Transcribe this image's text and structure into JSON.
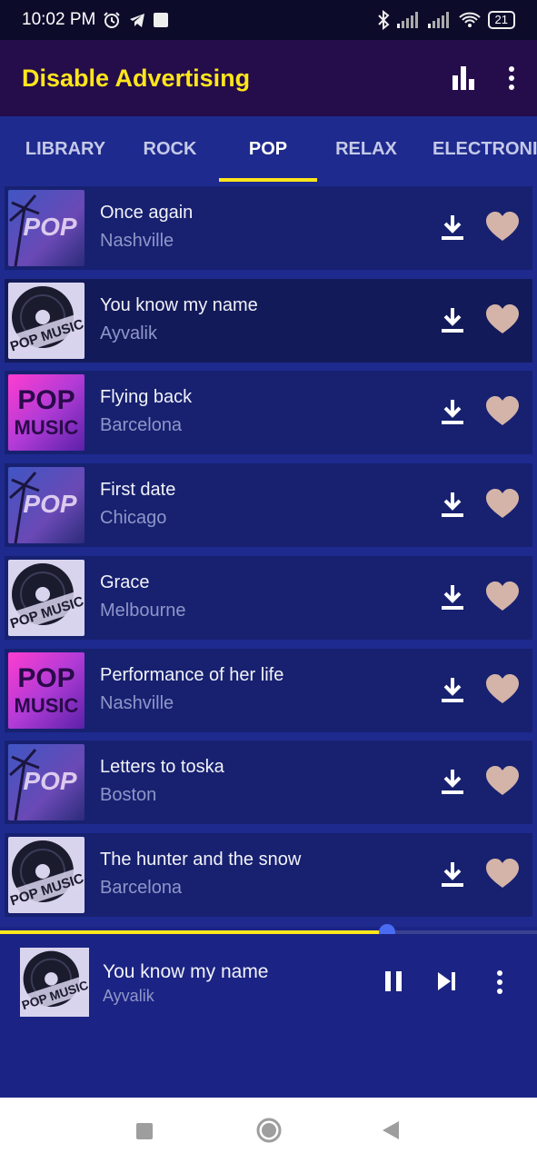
{
  "status_bar": {
    "time": "10:02 PM",
    "left_icons": [
      "alarm-icon",
      "telegram-icon",
      "notification-square-icon"
    ],
    "right_icons": [
      "bluetooth-icon",
      "signal-icon",
      "signal-icon",
      "wifi-icon"
    ],
    "battery": "21"
  },
  "app_bar": {
    "title": "Disable Advertising",
    "actions": [
      "equalizer-icon",
      "more-vert-icon"
    ],
    "title_color": "#ffe61b",
    "background": "#250c4b"
  },
  "tabs": [
    {
      "label": "LIBRARY",
      "active": false
    },
    {
      "label": "ROCK",
      "active": false
    },
    {
      "label": "POP",
      "active": true
    },
    {
      "label": "RELAX",
      "active": false
    },
    {
      "label": "ELECTRONIC",
      "active": false
    }
  ],
  "songs": [
    {
      "title": "Once again",
      "artist": "Nashville",
      "art": "pop-palm-art",
      "selected": false
    },
    {
      "title": "You know my name",
      "artist": "Ayvalik",
      "art": "pop-music-vinyl-art",
      "selected": true
    },
    {
      "title": "Flying back",
      "artist": "Barcelona",
      "art": "pop-music-pink-art",
      "selected": false
    },
    {
      "title": "First date",
      "artist": "Chicago",
      "art": "pop-palm-art",
      "selected": false
    },
    {
      "title": "Grace",
      "artist": "Melbourne",
      "art": "pop-music-vinyl-art",
      "selected": false
    },
    {
      "title": "Performance of her life",
      "artist": "Nashville",
      "art": "pop-music-pink-art",
      "selected": false
    },
    {
      "title": "Letters to toska",
      "artist": "Boston",
      "art": "pop-palm-art",
      "selected": false
    },
    {
      "title": "The hunter and the snow",
      "artist": "Barcelona",
      "art": "pop-music-vinyl-art",
      "selected": false
    }
  ],
  "row_actions": [
    "download-icon",
    "favorite-heart-icon"
  ],
  "art_text": {
    "pop": "POP",
    "pop_music": "POP MUSIC",
    "music": "MUSIC"
  },
  "player": {
    "title": "You know my name",
    "artist": "Ayvalik",
    "progress": 0.72,
    "controls": [
      "pause-icon",
      "skip-next-icon",
      "more-vert-icon"
    ]
  },
  "nav_bar": [
    "recents-square-icon",
    "home-circle-icon",
    "back-triangle-icon"
  ],
  "colors": {
    "accent_yellow": "#ffe61b",
    "list_background": "#1e2a8e",
    "row_background": "#172170",
    "heart": "#d4b4a8",
    "progress_knob": "#4a6cf3"
  }
}
